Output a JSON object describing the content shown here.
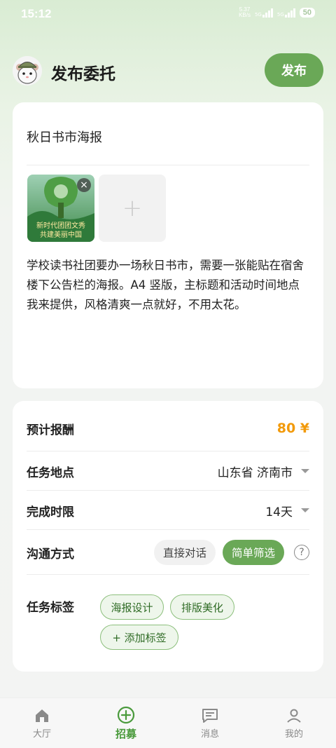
{
  "status_bar": {
    "time": "15:12",
    "net_speed_value": "5.37",
    "net_speed_unit": "KB/s",
    "signal1": "5G",
    "signal2": "5G",
    "battery": "50"
  },
  "header": {
    "title": "发布委托",
    "publish_label": "发布"
  },
  "task": {
    "title": "秋日书市海报",
    "image_caption_line1": "新时代团团文秀",
    "image_caption_line2": "共建美丽中国",
    "description": "学校读书社团要办一场秋日书市，需要一张能贴在宿舍楼下公告栏的海报。A4 竖版，主标题和活动时间地点我来提供，风格清爽一点就好，不用太花。"
  },
  "form": {
    "reward_label": "预计报酬",
    "reward_value": "80 ¥",
    "location_label": "任务地点",
    "location_value": "山东省 济南市",
    "deadline_label": "完成时限",
    "deadline_value": "14天",
    "contact_label": "沟通方式",
    "contact_options": [
      "直接对话",
      "简单筛选"
    ],
    "contact_selected": "简单筛选",
    "tags_label": "任务标签",
    "tags": [
      "海报设计",
      "排版美化"
    ],
    "add_tag_label": "+ 添加标签"
  },
  "nav": {
    "items": [
      {
        "label": "大厅",
        "icon": "home-icon"
      },
      {
        "label": "招募",
        "icon": "plus-circle-icon",
        "active": true
      },
      {
        "label": "消息",
        "icon": "message-icon"
      },
      {
        "label": "我的",
        "icon": "person-icon"
      }
    ]
  },
  "colors": {
    "accent": "#6aa857",
    "reward": "#f29a0a"
  }
}
